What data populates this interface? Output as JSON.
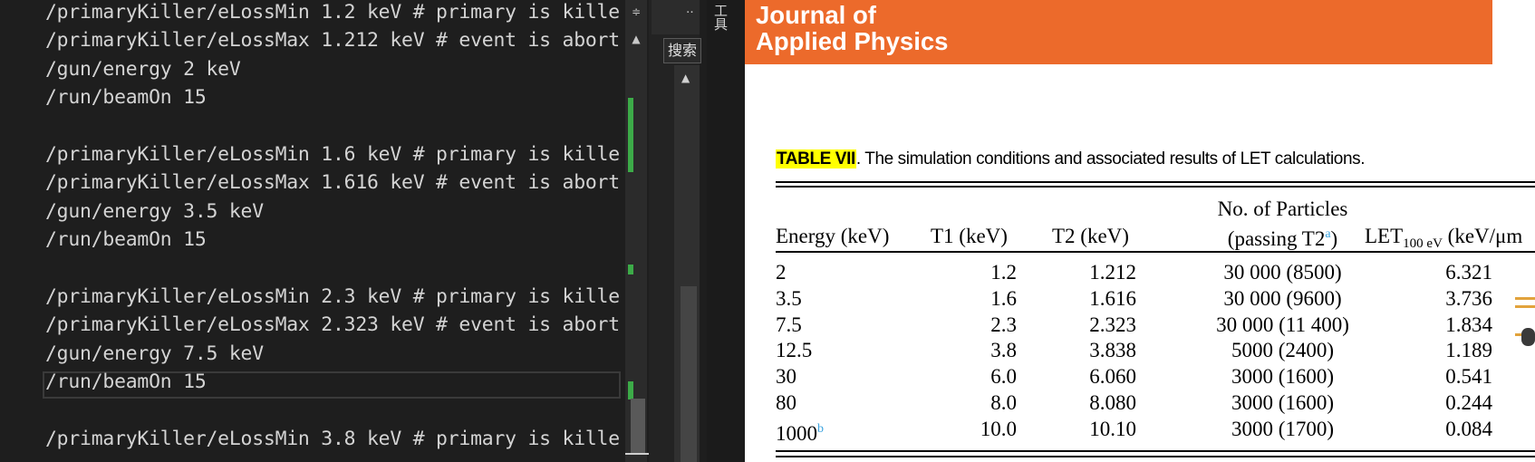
{
  "editor": {
    "lines": [
      "/primaryKiller/eLossMin 1.2 keV # primary is kille",
      "/primaryKiller/eLossMax 1.212 keV # event is abort",
      "/gun/energy 2 keV",
      "/run/beamOn 15",
      "",
      "/primaryKiller/eLossMin 1.6 keV # primary is kille",
      "/primaryKiller/eLossMax 1.616 keV # event is abort",
      "/gun/energy 3.5 keV",
      "/run/beamOn 15",
      "",
      "/primaryKiller/eLossMin 2.3 keV # primary is kille",
      "/primaryKiller/eLossMax 2.323 keV # event is abort",
      "/gun/energy 7.5 keV",
      "/run/beamOn 15",
      "",
      "/primaryKiller/eLossMin 3.8 keV # primary is kille"
    ]
  },
  "toolbar": {
    "search_tab": "搜索",
    "tools_label": "工具",
    "split_icon": "split-icon",
    "overflow_icon": "overflow-icon"
  },
  "journal": {
    "banner": {
      "line1": "Journal of",
      "line2": "Applied Physics",
      "color": "#ec6a2b"
    },
    "caption": {
      "label": "TABLE VII",
      "text": ". The simulation conditions and associated results of LET calculations."
    },
    "table": {
      "headers": {
        "energy": "Energy (keV)",
        "t1": "T1 (keV)",
        "t2": "T2 (keV)",
        "particles_line1": "No. of Particles",
        "particles_line2_pre": "(passing T2",
        "particles_footnote": "a",
        "particles_line2_post": ")",
        "let_main": "LET",
        "let_sub": "100 eV",
        "let_unit": " (keV/μm"
      },
      "rows": [
        {
          "energy": "2",
          "footnote": "",
          "t1": "1.2",
          "t2": "1.212",
          "particles": "30 000 (8500)",
          "let": "6.321"
        },
        {
          "energy": "3.5",
          "footnote": "",
          "t1": "1.6",
          "t2": "1.616",
          "particles": "30 000 (9600)",
          "let": "3.736"
        },
        {
          "energy": "7.5",
          "footnote": "",
          "t1": "2.3",
          "t2": "2.323",
          "particles": "30 000 (11 400)",
          "let": "1.834"
        },
        {
          "energy": "12.5",
          "footnote": "",
          "t1": "3.8",
          "t2": "3.838",
          "particles": "5000 (2400)",
          "let": "1.189"
        },
        {
          "energy": "30",
          "footnote": "",
          "t1": "6.0",
          "t2": "6.060",
          "particles": "3000 (1600)",
          "let": "0.541"
        },
        {
          "energy": "80",
          "footnote": "",
          "t1": "8.0",
          "t2": "8.080",
          "particles": "3000 (1600)",
          "let": "0.244"
        },
        {
          "energy": "1000",
          "footnote": "b",
          "t1": "10.0",
          "t2": "10.10",
          "particles": "3000 (1700)",
          "let": "0.084"
        }
      ]
    }
  }
}
